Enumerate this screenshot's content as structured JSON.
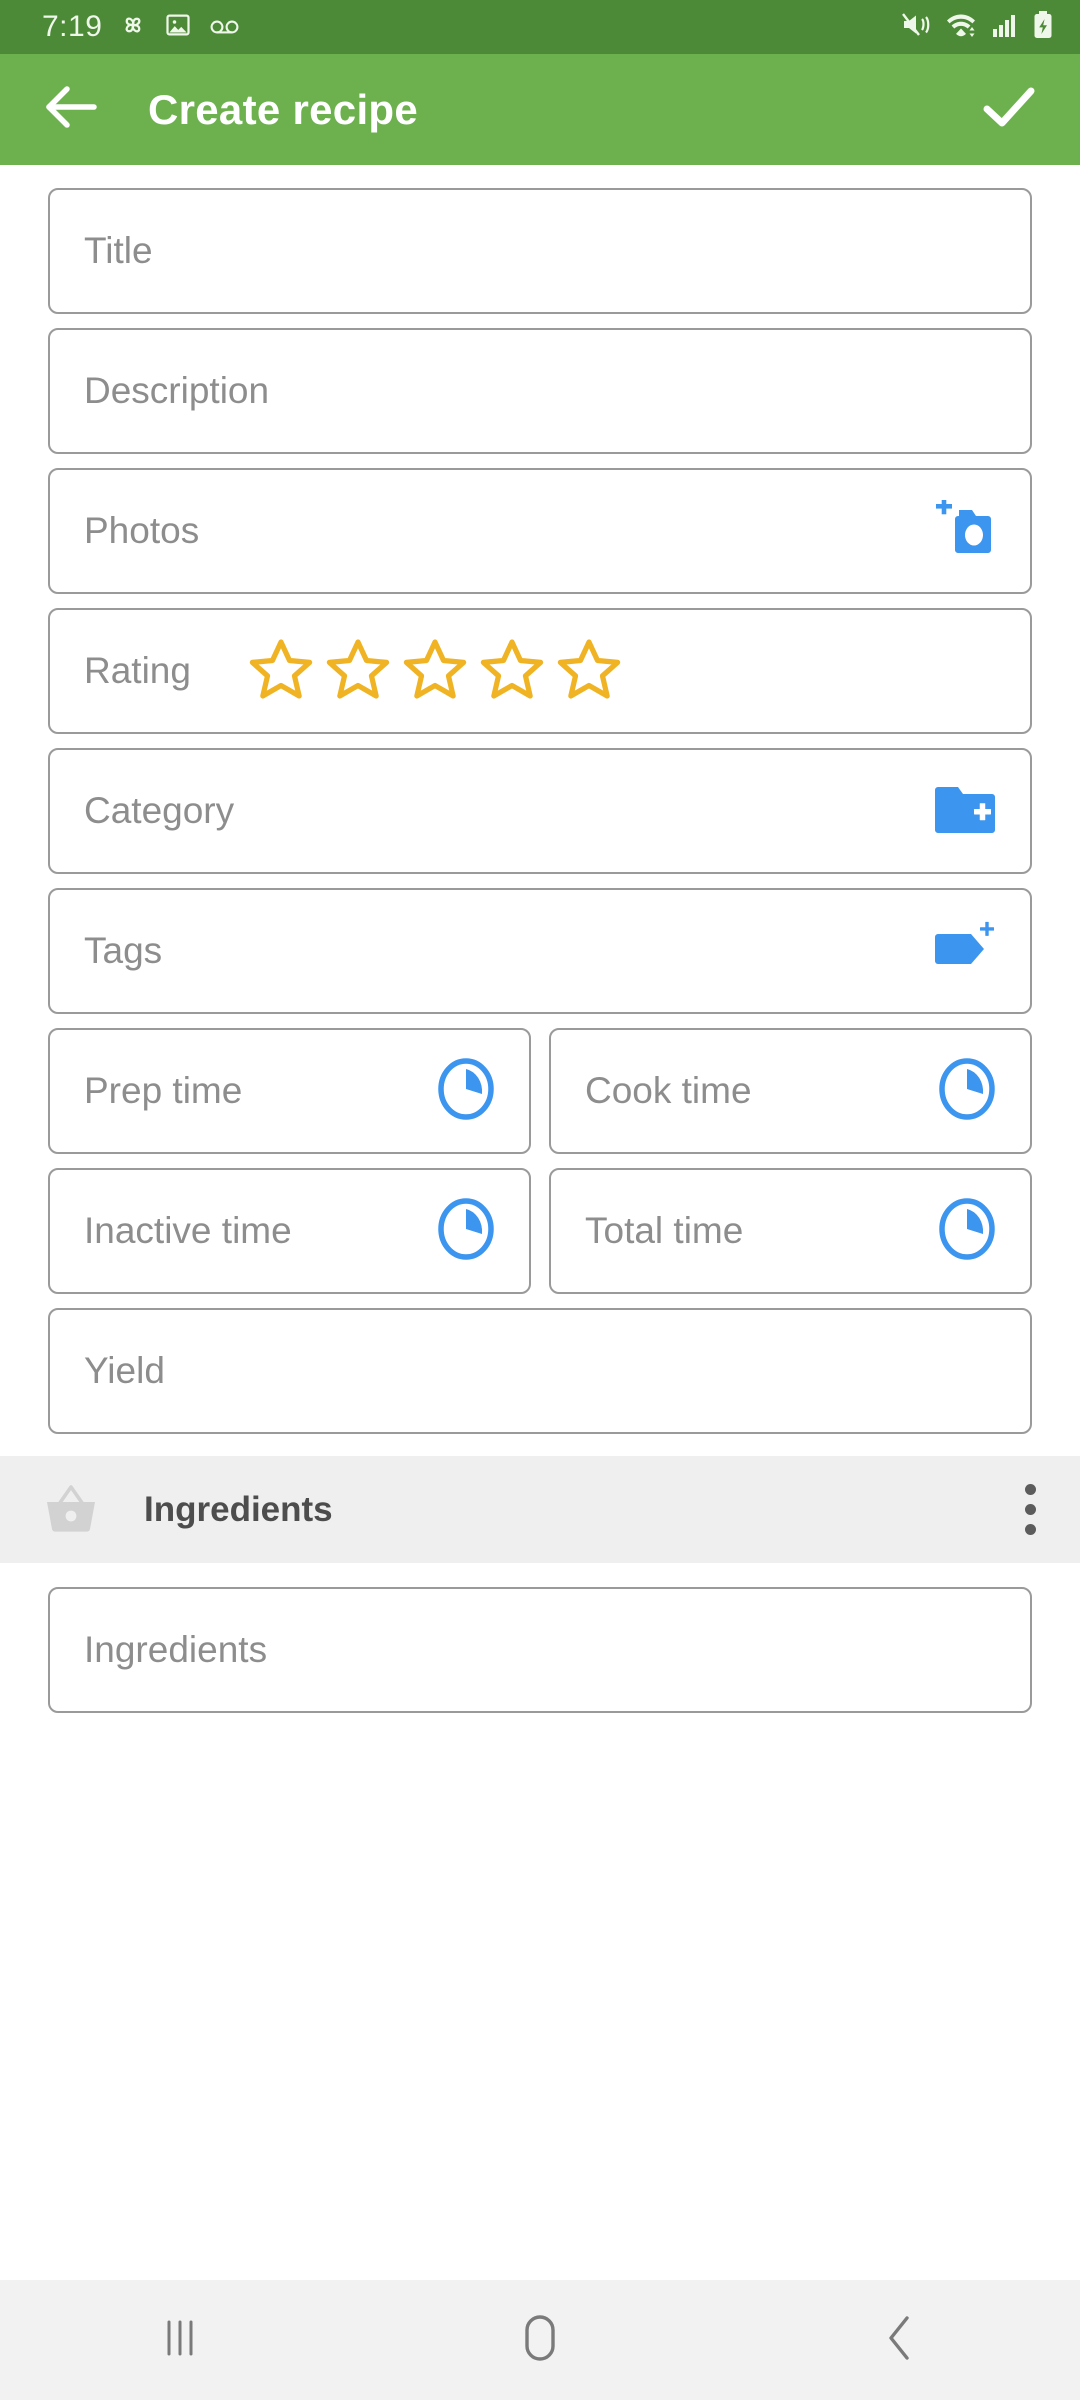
{
  "status_bar": {
    "time": "7:19",
    "left_icons": [
      "pinwheel-icon",
      "gallery-image-icon",
      "voicemail-icon"
    ],
    "right_icons": [
      "mute-vibrate-icon",
      "wifi-icon",
      "cellular-signal-icon",
      "battery-charging-icon"
    ],
    "background_color": "#4d8a37"
  },
  "app_bar": {
    "title": "Create recipe",
    "back_label": "back-arrow-icon",
    "confirm_label": "checkmark-icon",
    "background_color": "#6db14e",
    "text_color": "#ffffff"
  },
  "form": {
    "fields": [
      {
        "label": "Title",
        "placeholder": "Title",
        "icon": null
      },
      {
        "label": "Description",
        "placeholder": "Description",
        "icon": null
      },
      {
        "label": "Photos",
        "placeholder": "Photos",
        "icon": "add-photo-camera-icon"
      },
      {
        "label": "Rating",
        "placeholder": "Rating",
        "icon": "star-rating"
      },
      {
        "label": "Category",
        "placeholder": "Category",
        "icon": "add-folder-icon"
      },
      {
        "label": "Tags",
        "placeholder": "Tags",
        "icon": "add-tag-icon"
      },
      {
        "label": "Prep time",
        "placeholder": "Prep time",
        "icon": "clock-icon"
      },
      {
        "label": "Cook time",
        "placeholder": "Cook time",
        "icon": "clock-icon"
      },
      {
        "label": "Inactive time",
        "placeholder": "Inactive time",
        "icon": "clock-icon"
      },
      {
        "label": "Total time",
        "placeholder": "Total time",
        "icon": "clock-icon"
      },
      {
        "label": "Yield",
        "placeholder": "Yield",
        "icon": null
      }
    ],
    "rating": {
      "value": 0,
      "max": 5,
      "star_color": "#F0B323"
    },
    "icon_color": "#3C95EE",
    "placeholder_color": "#8d8d8d",
    "border_color": "#9a9a9a"
  },
  "ingredients_section": {
    "title": "Ingredients",
    "icon": "basket-icon",
    "overflow_menu": "more-options-icon",
    "background_color": "#efefef",
    "field": {
      "label": "Ingredients",
      "placeholder": "Ingredients"
    }
  },
  "nav_bar": {
    "buttons": [
      "recents-icon",
      "home-icon",
      "back-icon"
    ],
    "background_color": "#f2f2f2",
    "icon_color": "#7a7a7a"
  }
}
